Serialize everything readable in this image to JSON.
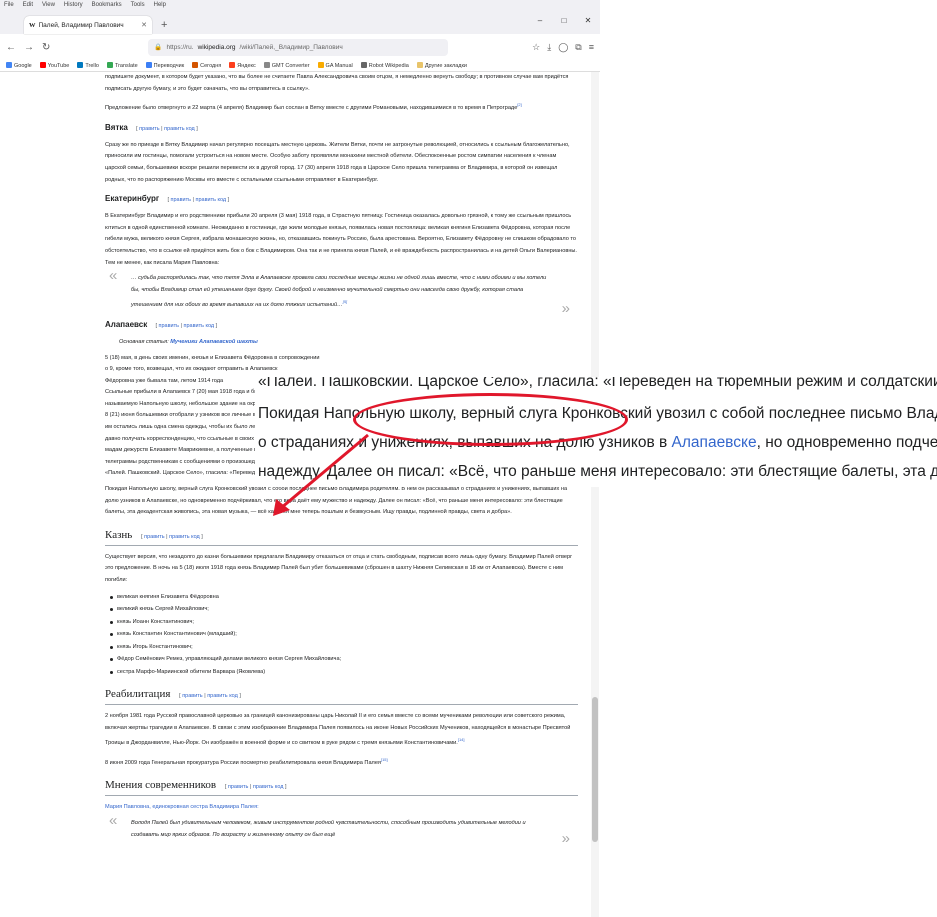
{
  "browser": {
    "menu": [
      "File",
      "Edit",
      "View",
      "History",
      "Bookmarks",
      "Tools",
      "Help"
    ],
    "tab_title": "Палей, Владимир Павлович",
    "url_prefix": "https://ru.",
    "url_domain": "wikipedia.org",
    "url_path": "/wiki/Палей,_Владимир_Павлович",
    "bookmarks": [
      "Google",
      "YouTube",
      "Trello",
      "Translate",
      "Переводчик",
      "Сегодня",
      "Яндекс",
      "GMT Converter",
      "GA Manual",
      "Robot Wikipedia",
      "Другие закладки"
    ]
  },
  "article": {
    "intro_p1": "подпишете документ, в котором будет указано, что вы более не считаете Павла Александровича своим отцом, я немедленно вернуть свободу; в противном случае вам придётся подписать другую бумагу, и это будет означать, что вы отправитесь в ссылку».",
    "intro_p2": "Предложение было отвергнуто и 22 марта (4 апреля) Владимир был сослан в Вятку вместе с другими Романовыми, находившимися в то время в Петрограде",
    "intro_ref": "[2]",
    "vyatka": {
      "title": "Вятка",
      "edit": "править",
      "edit_code": "править код",
      "text": "Сразу же по приезде в Вятку Владимир начал регулярно посещать местную церковь. Жители Вятки, почти не затронутые революцией, относились к ссыльным благожелательно, приносили им гостинцы, помогали устроиться на новом месте. Особую заботу проявляли монахини местной обители. Обеспокоенные ростом симпатии населения к членам царской семьи, большевики вскоре решили перевести их в другой город. 17 (30) апреля 1918 года в Царское Село пришла телеграмма от Владимира, в которой он извещал родных, что по распоряжению Москвы его вместе с остальными ссыльными отправляют в Екатеринбург."
    },
    "ekat": {
      "title": "Екатеринбург",
      "edit": "править",
      "edit_code": "править код",
      "text": "В Екатеринбург Владимир и его родственники прибыли 20 апреля (3 мая) 1918 года, в Страстную пятницу. Гостиница оказалась довольно грязной, к тому же ссыльным пришлось ютиться в одной единственной комнате. Неожиданно в гостинице, где жили молодые князья, появилась новая постоялица: великая княгиня Елизавета Фёдоровна, которая после гибели мужа, великого князя Сергея, избрала монашескую жизнь, но, отказавшись покинуть Россию, была арестована. Вероятно, Елизавету Фёдоровну не слишком обрадовало то обстоятельство, что в ссылке ей придётся жить бок о бок с Владимиром. Она так и не приняла князя Палей, и её враждебность распространилась и на детей Ольги Валериановны. Тем не менее, как писала Мария Павловна:",
      "quote": "… судьба распорядилась так, что тетя Элла в Алапаевске провела свои последние месяцы жизни не одной лишь вместе, что с ними обоими и мы хотели бы, чтобы Владимир стал ей утешением друг другу. Своей доброй и неизменно мучительной смертью они навсегда свою дружбу, которая стала утешением для них обоих во время выпавших на их долю тяжких испытаний…",
      "quote_ref": "[5]"
    },
    "alap": {
      "title": "Алапаевск",
      "edit": "править",
      "edit_code": "править код",
      "hatnote_prefix": "Основная статья:",
      "hatnote_link": "Мученики Алапаевской шахты",
      "lines": [
        "5 (18) мая, в день своих именин, князья и Елизавета Фёдоровна в сопровождении",
        "о 9, кроме того, возвещал, что их ожидают отправить в Алапаевск",
        "Фёдоровна уже бывала там, летом 1914 года",
        "Ссыльные прибыли в Алапаевск 7 (20) мая 1918 года и были поселены",
        "называемую Напольную школу, небольшое здание на окраине города",
        "8 (21) июня большевики отобрали у узников все личные вещи",
        "им остались лишь одна смена одежды, чтобы их было легче",
        "давно получать корреспонденцию, что ссыльные в своих письмах",
        "мадам дежурств Елизавете Маврикиевне, а полученные во время",
        "телеграммы родственникам с сообщениями о произошедших изменениях. Телеграмма, посланная в полдень Владимиром по адресу:",
        "«Палей. Пашковский. Царское Село», гласила: «Переведён на тюремный режим и солдатский паёк. Володя»."
      ],
      "p_school": "Покидая Напольную школу, верный слуга Кронковский увозил с собой последнее письмо Владимира родителям. В нём он рассказывал о страданиях и унижениях, выпавших на долю узников в Алапаевске, но одновременно подчёркивал, что его вера даёт ему мужество и надежду. Далее он писал: «Всё, что раньше меня интересовало: эти блестящие балеты, эта декадентская живопись, эта новая музыка, — всё кажется мне теперь пошлым и безвкусным. Ищу правды, подлинной правды, света и добра»."
    },
    "execution": {
      "title": "Казнь",
      "edit": "править",
      "edit_code": "править код",
      "text": "Существует версия, что незадолго до казни большевики предлагали Владимиру отказаться от отца и стать свободным, подписав всего лишь одну бумагу. Владимир Палей отверг это предложение. В ночь на 5 (18) июля 1918 года князь Владимир Палей был убит большевиками (сброшен в шахту Нижняя Селимская в 18 км от Алапаевска). Вместе с ним погибли:",
      "victims": [
        "великая княгиня Елизавета Фёдоровна",
        "великий князь Сергей Михайлович;",
        "князь Иоанн Константинович;",
        "князь Константин Константинович (младший);",
        "князь Игорь Константинович;",
        "Фёдор Семёнович Ремез, управляющий делами великого князя Сергея Михайловича;",
        "сестра Марфо-Мариинской обители Варвара (Яковлева)"
      ]
    },
    "rehab": {
      "title": "Реабилитация",
      "edit": "править",
      "edit_code": "править код",
      "p1": "2 ноября 1981 года Русской православной церковью за границей канонизированы царь Николай II и его семья вместе со всеми мучениками революции или советского режима, включая жертвы трагедии в Алапаевске. В связи с этим изображение Владимира Палея появилось на иконе Новых Российских Мучеников, находящейся в монастыре Пресвятой Троицы в Джорданвилле, Нью-Йорк. Он изображён в военной форме и со свитком в руке рядом с тремя князьями Константиновичами.",
      "p1_ref": "[14]",
      "p2": "8 июня 2009 года Генеральная прокуратура России посмертно реабилитировала князя Владимира Палея",
      "p2_ref": "[15]"
    },
    "opinions": {
      "title": "Мнения современников",
      "edit": "править",
      "edit_code": "править код",
      "lead": "Мария Павловна, единокровная сестра Владимира Палея:",
      "quote": "Володя Палей был удивительным человеком, живым инструментом родной чувствительности, способным производить удивительные мелодии и создавать мир ярких образов. По возрасту и жизненному опыту он был ещё"
    }
  },
  "zoom": {
    "l1": "«Палей. Пашковский. Царское Село», гласила: «Переведён на тюремный режим и солдатский паёк. Володя».",
    "l2": "Покидая Напольную школу, верный слуга Кронковский увозил с собой последнее письмо Владимира родителям.",
    "l3_a": "о страданиях и унижениях, выпавших на долю узников в ",
    "l3_link": "Алапаевске",
    "l3_b": ", но одновременно подчеркивал, что его вера",
    "l4": "надежду. Далее он писал: «Всё, что раньше меня интересовало: эти блестящие балеты, эта декадентская живопис"
  },
  "colors": {
    "link": "#3366cc",
    "annotation": "#e0172b"
  }
}
